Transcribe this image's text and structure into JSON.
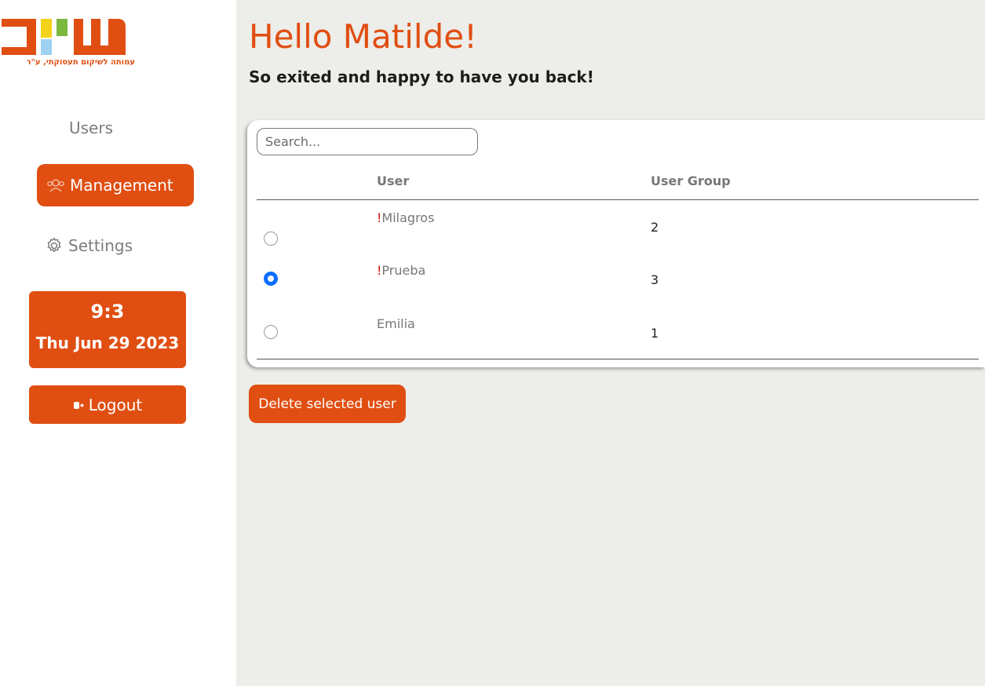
{
  "brand": {
    "logo_text": "שוים",
    "tagline": "עמותה לשיקום תעסוקתי, ע\"ר",
    "colors": {
      "accent": "#e04e12",
      "logo_blue": "#9ed0f0",
      "logo_yellow": "#f5d21a",
      "logo_green": "#7ab83e"
    }
  },
  "sidebar": {
    "items": [
      {
        "label": "Users",
        "icon": "none",
        "active": false
      },
      {
        "label": "Management",
        "icon": "users-icon",
        "active": true
      },
      {
        "label": "Settings",
        "icon": "gear-icon",
        "active": false
      }
    ],
    "clock": {
      "time": "9:3",
      "date": "Thu Jun 29 2023"
    },
    "logout_label": "Logout"
  },
  "header": {
    "greeting": "Hello Matilde!",
    "subtitle": "So exited and happy to have you back!"
  },
  "table": {
    "search_placeholder": "Search...",
    "columns": [
      "User",
      "User Group"
    ],
    "rows": [
      {
        "prefix": "!",
        "name": "Milagros",
        "group": "2",
        "selected": false
      },
      {
        "prefix": "!",
        "name": "Prueba",
        "group": "3",
        "selected": true
      },
      {
        "prefix": "",
        "name": "Emilia",
        "group": "1",
        "selected": false
      }
    ]
  },
  "actions": {
    "delete_label": "Delete selected user"
  }
}
